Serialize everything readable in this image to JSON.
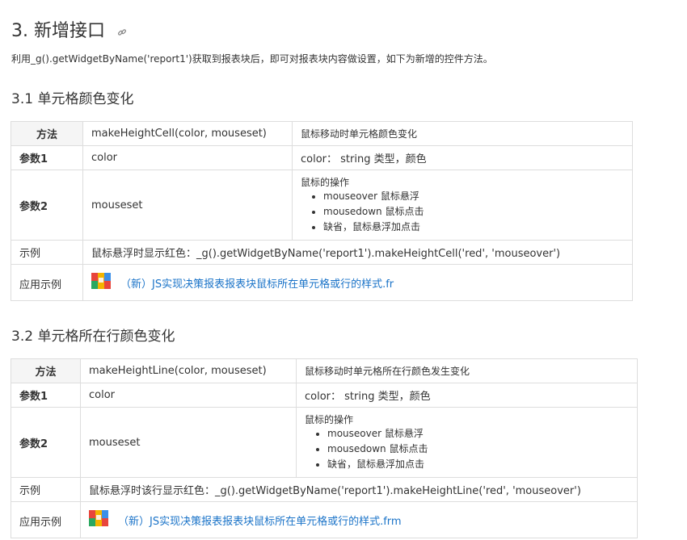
{
  "section": {
    "title": "3. 新增接口",
    "intro": "利用_g().getWidgetByName('report1')获取到报表块后，即可对报表块内容做设置，如下为新增的控件方法。"
  },
  "sub1": {
    "title": "3.1 单元格颜色变化",
    "method_label": "方法",
    "method_value": "makeHeightCell(color, mouseset)",
    "method_desc": "鼠标移动时单元格颜色变化",
    "param1_label": "参数1",
    "param1_value": "color",
    "param1_desc": "color： string 类型，颜色",
    "param2_label": "参数2",
    "param2_value": "mouseset",
    "param2_desc_title": "鼠标的操作",
    "param2_desc_items": [
      "mouseover 鼠标悬浮",
      "mousedown 鼠标点击",
      "缺省，鼠标悬浮加点击"
    ],
    "example_label": "示例",
    "example_value": "鼠标悬浮时显示红色：_g().getWidgetByName('report1').makeHeightCell('red', 'mouseover')",
    "app_label": "应用示例",
    "app_link": "（新）JS实现决策报表报表块鼠标所在单元格或行的样式.fr"
  },
  "sub2": {
    "title": "3.2 单元格所在行颜色变化",
    "method_label": "方法",
    "method_value": "makeHeightLine(color, mouseset)",
    "method_desc": "鼠标移动时单元格所在行颜色发生变化",
    "param1_label": "参数1",
    "param1_value": "color",
    "param1_desc": "color： string 类型，颜色",
    "param2_label": "参数2",
    "param2_value": "mouseset",
    "param2_desc_title": "鼠标的操作",
    "param2_desc_items": [
      "mouseover 鼠标悬浮",
      "mousedown 鼠标点击",
      "缺省，鼠标悬浮加点击"
    ],
    "example_label": "示例",
    "example_value": "鼠标悬浮时该行显示红色：_g().getWidgetByName('report1').makeHeightLine('red', 'mouseover')",
    "app_label": "应用示例",
    "app_link": "（新）JS实现决策报表报表块鼠标所在单元格或行的样式.frm"
  },
  "icons": {
    "anchor": "link-icon",
    "file": "fine-report-file-icon"
  },
  "colors": {
    "link": "#1a73c8",
    "border": "#dddddd",
    "header_bg": "#f5f5f5"
  }
}
